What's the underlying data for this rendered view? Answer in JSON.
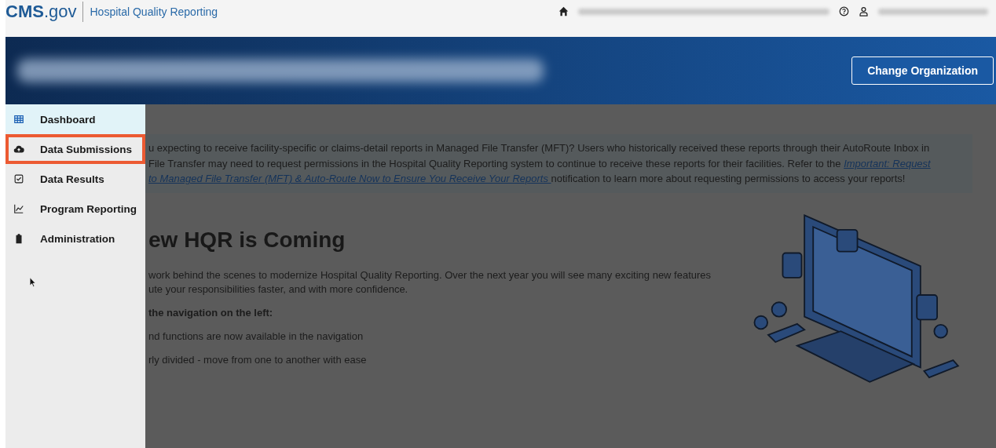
{
  "header": {
    "logo": "CMS",
    "logo_suffix": ".gov",
    "app_name": "Hospital Quality Reporting"
  },
  "banner": {
    "button": "Change Organization"
  },
  "sidebar": {
    "items": [
      {
        "label": "Dashboard",
        "selected": true,
        "highlighted": false
      },
      {
        "label": "Data Submissions",
        "selected": false,
        "highlighted": true
      },
      {
        "label": "Data Results",
        "selected": false,
        "highlighted": false
      },
      {
        "label": "Program Reporting",
        "selected": false,
        "highlighted": false
      },
      {
        "label": "Administration",
        "selected": false,
        "highlighted": false
      }
    ]
  },
  "notice": {
    "lines": [
      [
        {
          "text": "u expecting to receive facility-specific or claims-detail reports in Managed File Transfer (MFT)? Users who historically received these reports through their AutoRoute Inbox in",
          "link": false
        }
      ],
      [
        {
          "text": "File Transfer may need to request permissions in the Hospital Quality Reporting system to continue to receive these reports for their facilities. Refer to the ",
          "link": false
        },
        {
          "text": "Important: Request",
          "link": true
        }
      ],
      [
        {
          "text": "to Managed File Transfer (MFT) & Auto-Route Now to Ensure You Receive Your Reports ",
          "link": true
        },
        {
          "text": "notification to learn more about requesting permissions to access your reports!",
          "link": false
        }
      ]
    ]
  },
  "main": {
    "heading": "ew HQR is Coming",
    "lines": [
      {
        "text": "work behind the scenes to modernize Hospital Quality Reporting. Over the next year you will see many exciting new features",
        "kind": "body"
      },
      {
        "text": "ute your responsibilities faster, and with more confidence.",
        "kind": "body"
      },
      {
        "text": "the navigation on the left:",
        "kind": "bold"
      },
      {
        "text": "nd functions are now available in the navigation",
        "kind": "body"
      },
      {
        "text": "rly divided - move from one to another with ease",
        "kind": "body"
      }
    ]
  }
}
